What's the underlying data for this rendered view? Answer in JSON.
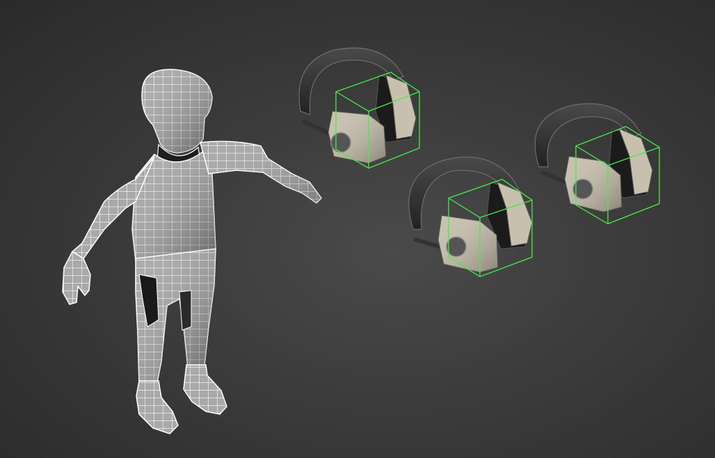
{
  "viewport": {
    "background": "#3b3b3b",
    "wireframe_color": "#ffffff",
    "selection_color": "#44ee44",
    "shaded_color": "#c8c0ae"
  },
  "scene_objects": [
    {
      "name": "character-mesh",
      "kind": "character",
      "display": "shaded-wireframe",
      "selected": false
    },
    {
      "name": "headphones-1",
      "kind": "headphones",
      "display": "shaded-edged-faces",
      "selected": true
    },
    {
      "name": "headphones-2",
      "kind": "headphones",
      "display": "shaded-edged-faces",
      "selected": true
    },
    {
      "name": "headphones-3",
      "kind": "headphones",
      "display": "shaded-edged-faces",
      "selected": true
    }
  ]
}
